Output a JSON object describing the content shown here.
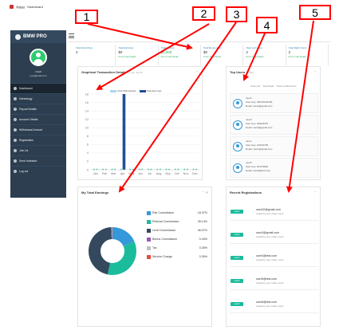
{
  "browser": {
    "tab_title": "@ggg · Dashboard"
  },
  "sidebar": {
    "brand": "BMW PRO",
    "user_name": "USER",
    "user_email": "user@mail.com",
    "items": [
      {
        "label": "Dashboard",
        "icon": "dashboard-icon",
        "active": true
      },
      {
        "label": "Genealogy",
        "icon": "tree-icon"
      },
      {
        "label": "Payout Details",
        "icon": "payout-icon"
      },
      {
        "label": "Account Details",
        "icon": "account-icon"
      },
      {
        "label": "Withdrawal Amount",
        "icon": "withdraw-icon"
      },
      {
        "label": "Registration",
        "icon": "register-icon"
      },
      {
        "label": "Join Us",
        "icon": "join-icon"
      },
      {
        "label": "Send Invitation",
        "icon": "invite-icon"
      },
      {
        "label": "Log out",
        "icon": "logout-icon"
      }
    ]
  },
  "stats": [
    {
      "label": "Total Downlines",
      "value": "4",
      "from": ""
    },
    {
      "label": "Total Earnings",
      "value": "$0",
      "from": "From Last Deals"
    },
    {
      "label": "Total Income",
      "value": "$5,000",
      "from": "From Last Deals",
      "green": true
    },
    {
      "label": "Total Bonus Earn",
      "value": "$0",
      "from": "From Last Deals"
    },
    {
      "label": "Total Left Users",
      "value": "2",
      "from": "From Last Deals"
    },
    {
      "label": "Total Right Users",
      "value": "2",
      "from": "From Last Deals"
    }
  ],
  "graph_panel": {
    "title": "Graphical Transaction Details",
    "subtitle": "by year, Month",
    "legend": [
      "Total Withdrawals",
      "Total Earnings"
    ]
  },
  "earnings_panel": {
    "title": "My Total Earnings",
    "subtitle": "",
    "rows": [
      {
        "label": "Pair Commission",
        "pct": "18.37%",
        "color": "#3498db"
      },
      {
        "label": "Referral Commission",
        "pct": "35.14%",
        "color": "#1abc9c"
      },
      {
        "label": "Level Commission",
        "pct": "46.07%",
        "color": "#34495e"
      },
      {
        "label": "Bonus Commission",
        "pct": "0.44%",
        "color": "#9b59b6"
      },
      {
        "label": "Tax",
        "pct": "0.26%",
        "color": "#bdc3c7"
      },
      {
        "label": "Service Charge",
        "pct": "0.26%",
        "color": "#e74c3c"
      }
    ]
  },
  "top_users": {
    "title": "Top Users",
    "subtitle": "Profiles",
    "tabs": [
      "Total Left",
      "Total Right",
      "Total Left Business"
    ],
    "users": [
      {
        "name": "user2",
        "key": "User Key: 2607/0042TRL",
        "extra": "Email: user2@gmail.com"
      },
      {
        "name": "user3",
        "key": "User Key: 2692/4457",
        "extra": "Email: user3@gmail.com"
      },
      {
        "name": "user1",
        "key": "User Key: 1463/4750",
        "extra": "Email: user1@gmail.com"
      },
      {
        "name": "user5",
        "key": "User Key: 2617/4862",
        "extra": "Email: user5@test.com"
      }
    ]
  },
  "recent": {
    "title": "Recent Registrations",
    "rows": [
      {
        "badge": "user1",
        "email": "user02@gmail.com",
        "meta": "created by user. Under: user2"
      },
      {
        "badge": "user3",
        "email": "user3@gmail.com",
        "meta": "created by user. Under: user2"
      },
      {
        "badge": "user4",
        "email": "user4@test.com",
        "meta": "created by user. Under: user2"
      },
      {
        "badge": "user5",
        "email": "user5@test.com",
        "meta": "created by user. Under: user2"
      },
      {
        "badge": "user6",
        "email": "user6@test.com",
        "meta": "created by user. Under: user2"
      }
    ]
  },
  "annotations": [
    "1",
    "2",
    "3",
    "4",
    "5"
  ],
  "chart_data": [
    {
      "type": "bar",
      "categories": [
        "Jan",
        "Feb",
        "Mar",
        "Apr",
        "May",
        "Jun",
        "Jul",
        "Aug",
        "Sep",
        "Oct",
        "Nov",
        "Dec"
      ],
      "series": [
        {
          "name": "Total Withdrawals",
          "values": [
            0,
            0,
            0,
            0,
            0,
            0,
            0,
            0,
            0,
            0,
            0,
            0
          ],
          "color": "#aed6f1"
        },
        {
          "name": "Total Earnings",
          "values": [
            0,
            0,
            0,
            18,
            0,
            0,
            0,
            0,
            0,
            0,
            0,
            0
          ],
          "color": "#1f4e9a"
        }
      ],
      "ylim": [
        0,
        18
      ],
      "yticks": [
        0,
        2,
        4,
        6,
        8,
        10,
        12,
        14,
        16,
        18
      ]
    },
    {
      "type": "pie",
      "labels": [
        "Pair Commission",
        "Referral Commission",
        "Level Commission",
        "Bonus Commission",
        "Tax",
        "Service Charge"
      ],
      "values": [
        18.37,
        35.14,
        46.07,
        0.44,
        0.26,
        0.26
      ],
      "colors": [
        "#3498db",
        "#1abc9c",
        "#34495e",
        "#9b59b6",
        "#bdc3c7",
        "#e74c3c"
      ],
      "donut": true
    }
  ]
}
